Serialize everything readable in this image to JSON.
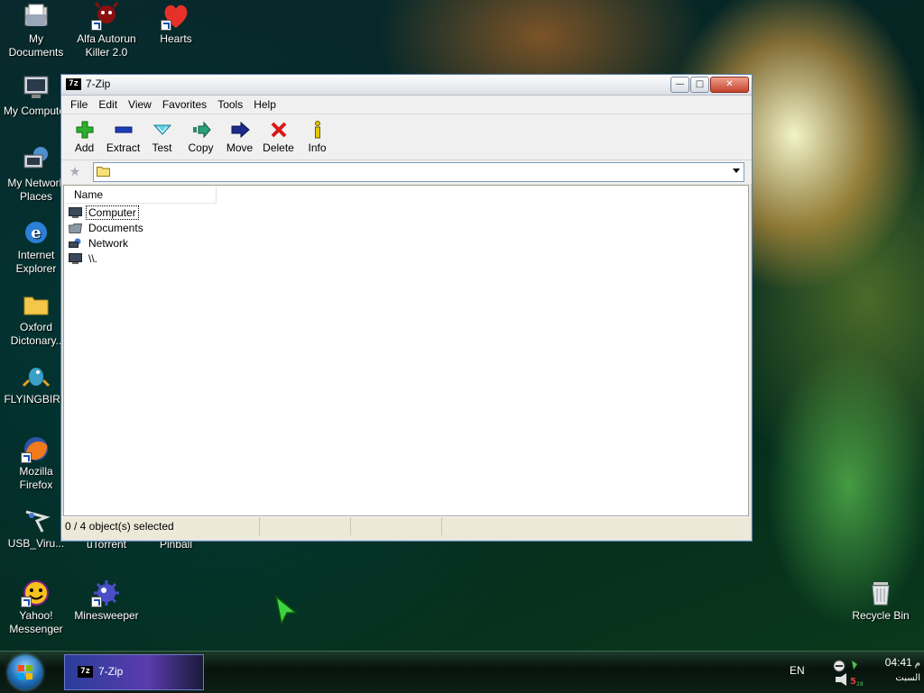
{
  "desktop": {
    "icons": [
      {
        "label": "My\nDocuments",
        "icon": "my-documents-icon",
        "shortcut": false
      },
      {
        "label": "Alfa Autorun\nKiller 2.0",
        "icon": "alfa-autorun-killer-icon",
        "shortcut": true
      },
      {
        "label": "Hearts",
        "icon": "hearts-icon",
        "shortcut": true
      },
      {
        "label": "My Computer",
        "icon": "my-computer-icon",
        "shortcut": false
      },
      {
        "label": "My Network\nPlaces",
        "icon": "my-network-places-icon",
        "shortcut": false
      },
      {
        "label": "Internet\nExplorer",
        "icon": "internet-explorer-icon",
        "shortcut": false
      },
      {
        "label": "Oxford\nDictonary..",
        "icon": "oxford-dictionary-folder-icon",
        "shortcut": false
      },
      {
        "label": "FLYINGBIRD",
        "icon": "flyingbird-icon",
        "shortcut": false
      },
      {
        "label": "Mozilla\nFirefox",
        "icon": "firefox-icon",
        "shortcut": true
      },
      {
        "label": "USB_Viru...",
        "icon": "usb-virus-icon",
        "shortcut": false
      },
      {
        "label": "uTorrent",
        "icon": "utorrent-icon",
        "shortcut": false
      },
      {
        "label": "Pinball",
        "icon": "pinball-icon",
        "shortcut": false
      },
      {
        "label": "Yahoo!\nMessenger",
        "icon": "yahoo-messenger-icon",
        "shortcut": true
      },
      {
        "label": "Minesweeper",
        "icon": "minesweeper-icon",
        "shortcut": true
      },
      {
        "label": "Recycle Bin",
        "icon": "recycle-bin-icon",
        "shortcut": false
      }
    ]
  },
  "window": {
    "title": "7-Zip",
    "icon_text": "7z",
    "menu": [
      "File",
      "Edit",
      "View",
      "Favorites",
      "Tools",
      "Help"
    ],
    "toolbar": [
      {
        "label": "Add",
        "icon": "add-icon"
      },
      {
        "label": "Extract",
        "icon": "extract-icon"
      },
      {
        "label": "Test",
        "icon": "test-icon"
      },
      {
        "label": "Copy",
        "icon": "copy-icon"
      },
      {
        "label": "Move",
        "icon": "move-icon"
      },
      {
        "label": "Delete",
        "icon": "delete-icon"
      },
      {
        "label": "Info",
        "icon": "info-icon"
      }
    ],
    "address": {
      "value": ""
    },
    "list": {
      "columns": [
        "Name"
      ],
      "rows": [
        {
          "name": "Computer",
          "icon": "computer-icon"
        },
        {
          "name": "Documents",
          "icon": "documents-icon"
        },
        {
          "name": "Network",
          "icon": "network-icon"
        },
        {
          "name": "\\\\.",
          "icon": "device-icon"
        }
      ]
    },
    "status": {
      "selection": "0 / 4 object(s) selected"
    }
  },
  "taskbar": {
    "task_label": "7-Zip",
    "language": "EN",
    "clock_time": "04:41",
    "clock_ampm": "م",
    "clock_day": "السبت"
  },
  "colors": {
    "accent": "#1f6fb8",
    "add": "#2db02d",
    "delete": "#d81818",
    "move": "#1c2a8c",
    "close_button": "#c0432b"
  }
}
